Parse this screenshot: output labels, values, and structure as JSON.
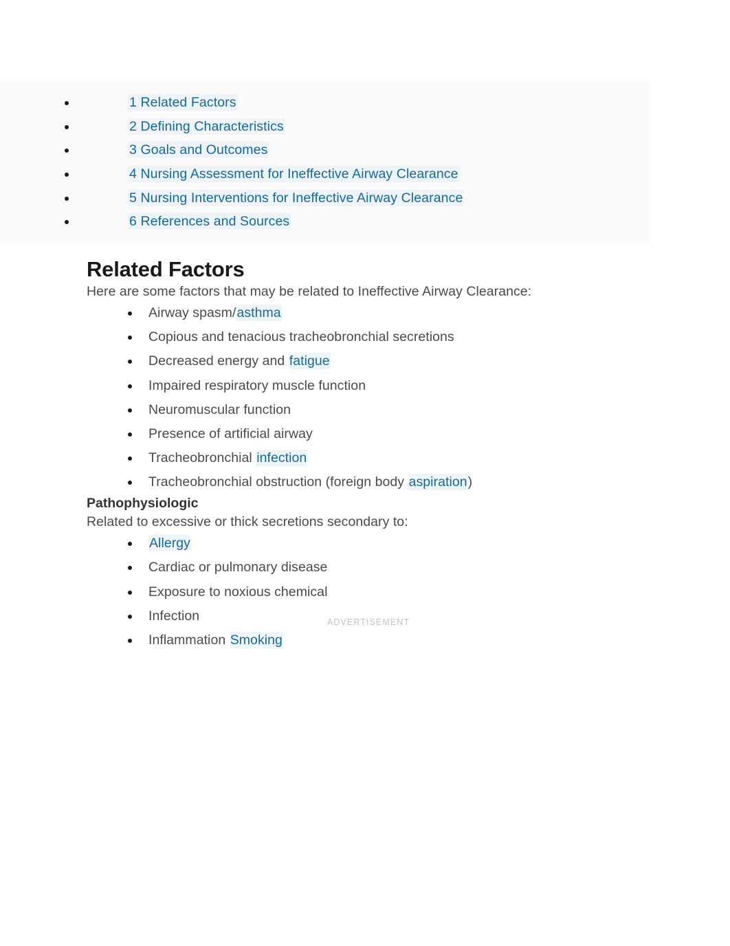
{
  "toc": {
    "items": [
      {
        "label": "1 Related Factors"
      },
      {
        "label": "2 Defining Characteristics"
      },
      {
        "label": "3 Goals and Outcomes"
      },
      {
        "label": "4 Nursing Assessment for Ineffective Airway Clearance"
      },
      {
        "label": "5 Nursing Interventions for Ineffective Airway Clearance"
      },
      {
        "label": "6 References and Sources"
      }
    ]
  },
  "article": {
    "section_title": "Related Factors",
    "intro_paragraph": "Here are some factors that may be related to Ineffective Airway Clearance:",
    "related_factors": [
      {
        "pre": "Airway spasm/",
        "link": "asthma",
        "post": ""
      },
      {
        "pre": "Copious and tenacious tracheobronchial secretions",
        "link": "",
        "post": ""
      },
      {
        "pre": "Decreased energy and ",
        "link": "fatigue",
        "post": ""
      },
      {
        "pre": "Impaired respiratory muscle function",
        "link": "",
        "post": ""
      },
      {
        "pre": "Neuromuscular function",
        "link": "",
        "post": ""
      },
      {
        "pre": "Presence of artificial airway",
        "link": "",
        "post": ""
      },
      {
        "pre": "Tracheobronchial ",
        "link": "infection",
        "post": ""
      },
      {
        "pre": "Tracheobronchial obstruction (foreign body ",
        "link": "aspiration",
        "post": ")"
      }
    ],
    "patho_title": "Pathophysiologic",
    "advertisement_label": "ADVERTISEMENT",
    "secondary_paragraph": "Related to excessive or thick secretions secondary to:",
    "secondary_factors": [
      {
        "pre": "",
        "link": "Allergy",
        "post": ""
      },
      {
        "pre": "Cardiac or pulmonary disease",
        "link": "",
        "post": ""
      },
      {
        "pre": "Exposure to noxious chemical",
        "link": "",
        "post": ""
      },
      {
        "pre": "Infection",
        "link": "",
        "post": ""
      },
      {
        "pre": "Inflammation ",
        "link": "Smoking",
        "post": ""
      }
    ]
  },
  "colors": {
    "link": "#16689c",
    "body_text": "#4a4a4a",
    "heading": "#191919",
    "subheading": "#333333",
    "toc_background": "#fafafa",
    "ad_label": "#c2c2c2",
    "page_background": "#ffffff"
  }
}
